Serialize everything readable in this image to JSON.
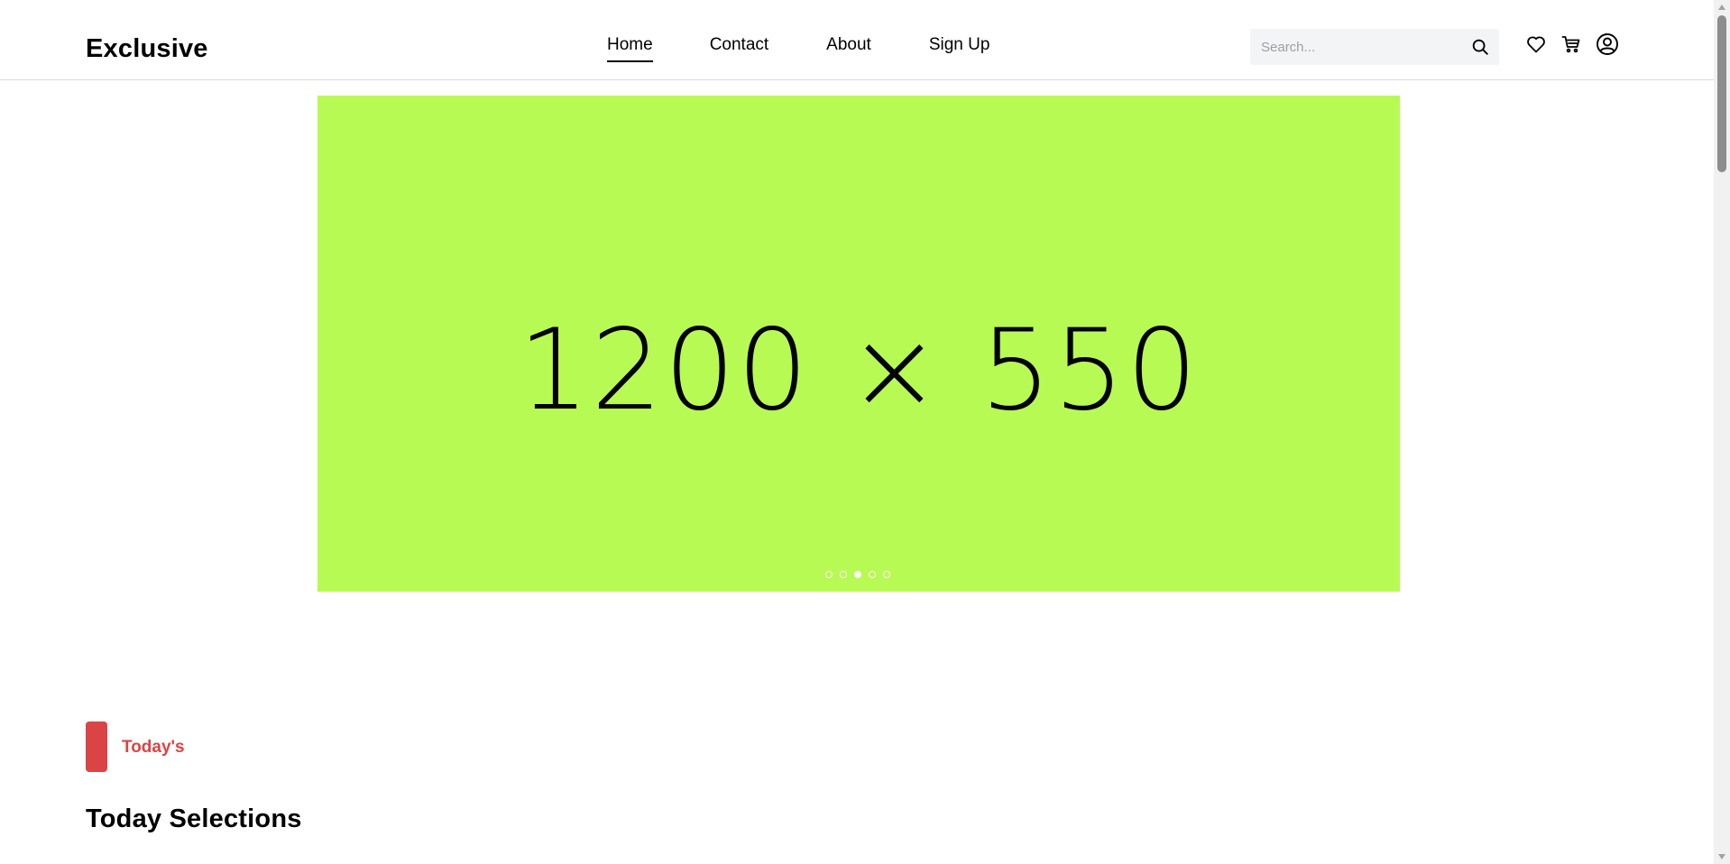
{
  "header": {
    "logo": "Exclusive",
    "nav": [
      {
        "label": "Home",
        "active": true
      },
      {
        "label": "Contact",
        "active": false
      },
      {
        "label": "About",
        "active": false
      },
      {
        "label": "Sign Up",
        "active": false
      }
    ],
    "search": {
      "placeholder": "Search...",
      "value": ""
    },
    "icons": [
      "heart-icon",
      "cart-icon",
      "user-icon",
      "search-icon"
    ]
  },
  "hero": {
    "placeholder_text": "1200 × 550",
    "background_color": "#b8fa54",
    "slide_count": 5,
    "active_slide_index": 2
  },
  "today_section": {
    "tag_label": "Today's",
    "title": "Today Selections",
    "accent_color": "#db4444"
  }
}
